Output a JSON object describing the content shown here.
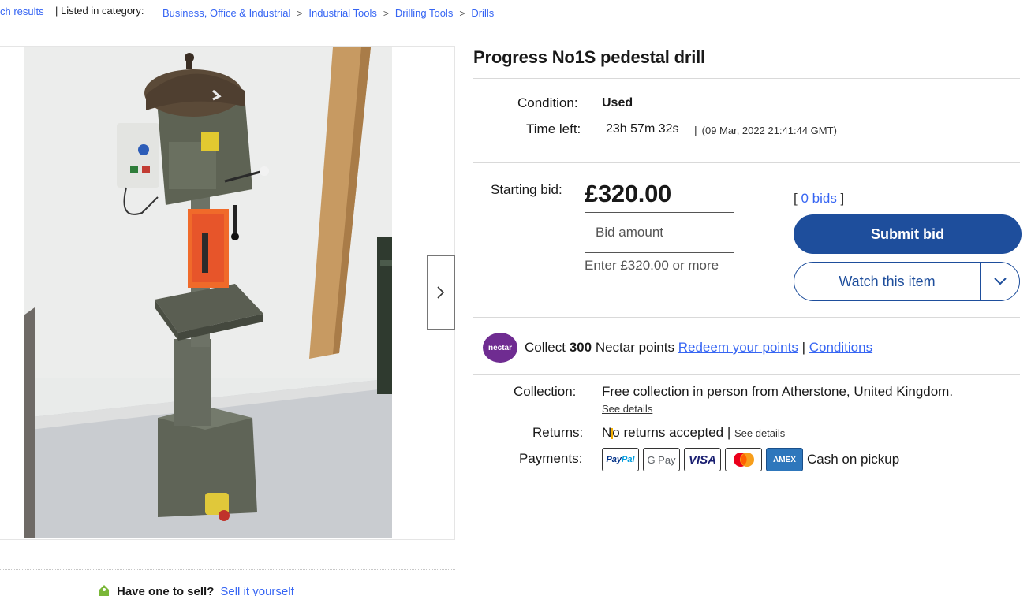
{
  "breadcrumb": {
    "back_label": "ch results",
    "listed_label": "| Listed in category:",
    "path": [
      "Business, Office & Industrial",
      "Industrial Tools",
      "Drilling Tools",
      "Drills"
    ],
    "separator": ">"
  },
  "listing": {
    "title": "Progress No1S pedestal drill",
    "condition_label": "Condition:",
    "condition": "Used",
    "time_left_label": "Time left:",
    "time_left": "23h 57m 32s",
    "end_time": "(09 Mar, 2022   21:41:44 GMT)"
  },
  "bidding": {
    "starting_bid_label": "Starting bid:",
    "price": "£320.00",
    "bid_placeholder": "Bid amount",
    "hint": "Enter £320.00 or more",
    "bids_open": "[ ",
    "bids_count": "0 bids",
    "bids_close": " ]",
    "submit_label": "Submit bid",
    "watch_label": "Watch this item"
  },
  "nectar": {
    "logo_text": "nectar",
    "collect_label": "Collect",
    "points": "300",
    "points_suffix": "Nectar points",
    "redeem_link": "Redeem your points",
    "separator": "|",
    "conditions_link": "Conditions"
  },
  "shipping": {
    "collection_label": "Collection:",
    "collection_value": "Free collection in person from Atherstone, United Kingdom.",
    "see_details": "See details",
    "returns_label": "Returns:",
    "returns_value_a": "N",
    "returns_value_b": "o returns accepted",
    "returns_sep": " | ",
    "returns_see_details": "See details",
    "payments_label": "Payments:",
    "payment_methods": [
      {
        "name": "PayPal",
        "icon": "paypal-icon"
      },
      {
        "name": "G Pay",
        "icon": "google-pay-icon"
      },
      {
        "name": "VISA",
        "icon": "visa-icon"
      },
      {
        "name": "Mastercard",
        "icon": "mastercard-icon"
      },
      {
        "name": "AMEX",
        "icon": "amex-icon"
      }
    ],
    "cash_label": "Cash on pickup"
  },
  "sell": {
    "question": "Have one to sell?",
    "link": "Sell it yourself"
  },
  "colors": {
    "link": "#3665f3",
    "primary_button": "#1e4e9c",
    "nectar": "#6f2c91"
  }
}
